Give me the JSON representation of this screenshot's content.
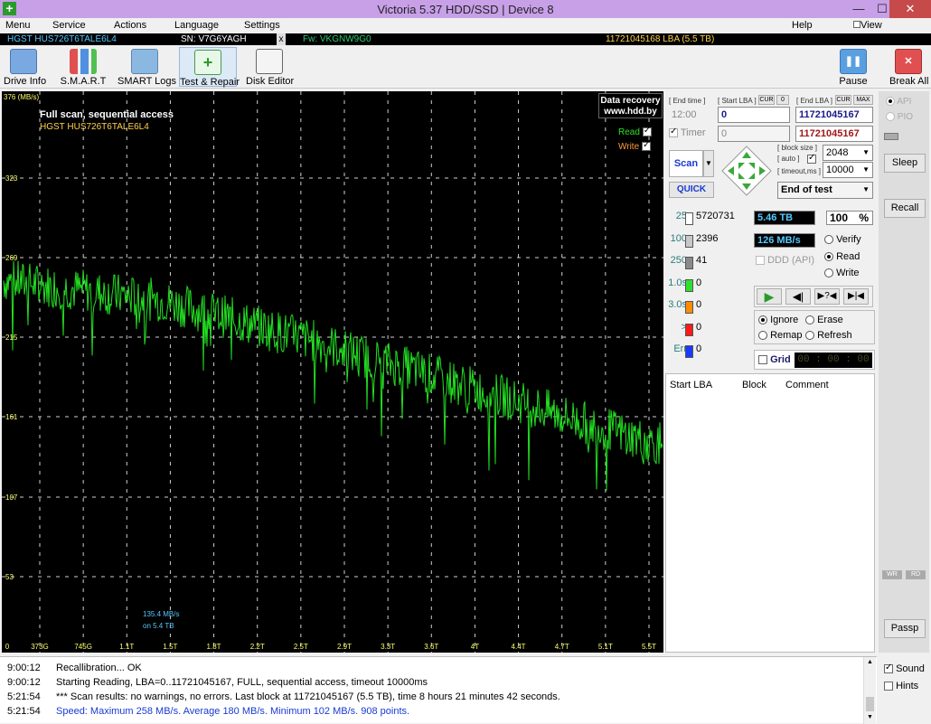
{
  "window": {
    "title": "Victoria 5.37 HDD/SSD | Device 8"
  },
  "menu": {
    "items": [
      "Menu",
      "Service",
      "Actions",
      "Language",
      "Settings"
    ],
    "help": "Help",
    "view_buffer": "View Buffer Live"
  },
  "info": {
    "model": "HGST HUS726T6TALE6L4",
    "sn": "SN: V7G6YAGH",
    "close": "x",
    "fw": "Fw: VKGNW9G0",
    "lba": "11721045168 LBA (5.5 TB)"
  },
  "toolbar": {
    "drive_info": "Drive Info",
    "smart": "S.M.A.R.T",
    "smart_logs": "SMART Logs",
    "test_repair": "Test & Repair",
    "disk_editor": "Disk Editor",
    "pause": "Pause",
    "break_all": "Break All"
  },
  "graph": {
    "unit": "376 (MB/s)",
    "title": "Full scan, sequential access",
    "subtitle": "HGST HUS726T6TALE6L4",
    "watermark1": "Data recovery",
    "watermark2": "www.hdd.by",
    "read_label": "Read",
    "write_label": "Write",
    "cursor1": "135.4 MB/s",
    "cursor2": "on 5.4 TB",
    "yticks": [
      "323",
      "269",
      "215",
      "161",
      "107",
      "53"
    ],
    "xticks": [
      "0",
      "373G",
      "745G",
      "1.1T",
      "1.5T",
      "1.8T",
      "2.2T",
      "2.5T",
      "2.9T",
      "3.3T",
      "3.6T",
      "4T",
      "4.4T",
      "4.7T",
      "5.1T",
      "5.5T"
    ]
  },
  "chart_data": {
    "type": "line",
    "title": "Full scan, sequential access",
    "ylabel": "MB/s",
    "ylim": [
      0,
      376
    ],
    "series": [
      {
        "name": "Read",
        "values": [
          250,
          248,
          246,
          244,
          242,
          240,
          238,
          236,
          232,
          228,
          224,
          219,
          215,
          211,
          207,
          202,
          197,
          193,
          189,
          184,
          179,
          174,
          170,
          165,
          160,
          155,
          150,
          146,
          141,
          137
        ]
      }
    ]
  },
  "panel": {
    "end_time_hdr": "[ End time ]",
    "start_lba_hdr": "[ Start LBA ]",
    "cur": "CUR",
    "zero": "0",
    "end_lba_hdr": "[ End LBA ]",
    "max": "MAX",
    "end_time": "12:00",
    "start_lba": "0",
    "end_lba": "11721045167",
    "timer": "Timer",
    "timer_val": "0",
    "end_lba2": "11721045167",
    "scan": "Scan",
    "quick": "QUICK",
    "block_size_hdr": "[ block size ]",
    "auto_hdr": "[ auto ]",
    "timeout_hdr": "[ timeout,ms ]",
    "block_size": "2048",
    "timeout": "10000",
    "end_of_test": "End of test",
    "size": "5.46 TB",
    "percent": "100",
    "percent_sign": "%",
    "speed": "126 MB/s",
    "verify": "Verify",
    "read": "Read",
    "write": "Write",
    "ddd": "DDD (API)",
    "ignore": "Ignore",
    "erase": "Erase",
    "remap": "Remap",
    "refresh": "Refresh",
    "grid": "Grid",
    "grid_time": "00 : 00 : 00"
  },
  "legend": [
    {
      "label": "25",
      "count": "5720731",
      "color": "#ffffff",
      "lc": "#2a7a7a"
    },
    {
      "label": "100",
      "count": "2396",
      "color": "#c8c8c8",
      "lc": "#2a7a7a"
    },
    {
      "label": "250",
      "count": "41",
      "color": "#8a8a8a",
      "lc": "#2a7a7a"
    },
    {
      "label": "1.0s",
      "count": "0",
      "color": "#2ee02e",
      "lc": "#2a7a7a"
    },
    {
      "label": "3.0s",
      "count": "0",
      "color": "#ff8c00",
      "lc": "#2a7a7a"
    },
    {
      "label": ">",
      "count": "0",
      "color": "#ff1a1a",
      "lc": "#2a7a7a"
    },
    {
      "label": "Err",
      "count": "0",
      "color": "#1a3aff",
      "lc": "#2a7a7a"
    }
  ],
  "table": {
    "headers": [
      "Start LBA",
      "Block",
      "Comment"
    ]
  },
  "side": {
    "api": "API",
    "pio": "PIO",
    "sleep": "Sleep",
    "recall": "Recall",
    "passp": "Passp",
    "wr": "WR",
    "rd": "RD"
  },
  "log": [
    {
      "time": "9:00:12",
      "msg": "Recallibration... OK",
      "color": "#000000"
    },
    {
      "time": "9:00:12",
      "msg": "Starting Reading, LBA=0..11721045167, FULL, sequential access, timeout 10000ms",
      "color": "#000000"
    },
    {
      "time": "5:21:54",
      "msg": "*** Scan results: no warnings, no errors. Last block at 11721045167 (5.5 TB), time 8 hours 21 minutes 42 seconds.",
      "color": "#000000"
    },
    {
      "time": "5:21:54",
      "msg": "Speed: Maximum 258 MB/s. Average 180 MB/s. Minimum 102 MB/s. 908 points.",
      "color": "#1a3ad0"
    }
  ],
  "logopts": {
    "sound": "Sound",
    "hints": "Hints"
  }
}
